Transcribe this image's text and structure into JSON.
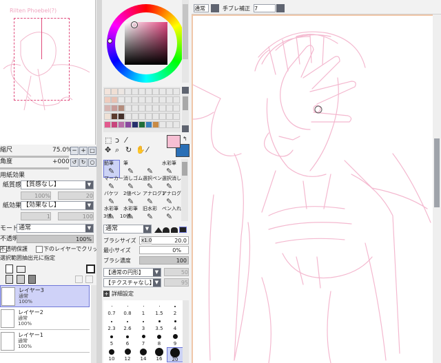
{
  "colors": {
    "accent": "#6d76d8",
    "sketch": "#f4b8cf",
    "primary": "#f6bfd3",
    "secondary": "#2a6fb6",
    "navigator_frame": "#e0487a"
  },
  "top_toolbar": {
    "blend_mode": "通常",
    "stabilizer_label": "手ブレ補正",
    "stabilizer_value": "7"
  },
  "navigator": {
    "zoom_label": "縮尺",
    "zoom_value": "75.0%",
    "angle_label": "角度",
    "angle_value": "+000°"
  },
  "layer_props": {
    "paper_section": "用紙効果",
    "paper_texture_label": "紙質感",
    "paper_texture_value": "【質感なし】",
    "paper_value_a": "100%",
    "paper_value_b": "20",
    "effect_label": "紙効果",
    "effect_value": "【効果なし】",
    "effect_value_a": "1",
    "effect_value_b": "100",
    "mode_label": "モード",
    "mode_value": "通常",
    "opacity_label": "不透明度",
    "opacity_value": "100%",
    "protect_label": "不透明保護",
    "clip_label": "下のレイヤーでクリッピング",
    "selection_label": "選択範囲抽出元に指定"
  },
  "layers": [
    {
      "name": "レイヤー3",
      "mode": "通常",
      "opacity": "100%",
      "selected": true
    },
    {
      "name": "レイヤー2",
      "mode": "通常",
      "opacity": "100%",
      "selected": false
    },
    {
      "name": "レイヤー1",
      "mode": "通常",
      "opacity": "100%",
      "selected": false
    }
  ],
  "tools": [
    {
      "label": "鉛筆",
      "icon": "pencil-icon",
      "selected": true
    },
    {
      "label": "筆",
      "icon": "brush-icon",
      "selected": false
    },
    {
      "label": "",
      "icon": "spray-icon",
      "selected": false
    },
    {
      "label": "水彩筆",
      "icon": "watercolor-icon",
      "selected": false
    },
    {
      "label": "マーカー",
      "icon": "marker-icon",
      "selected": false
    },
    {
      "label": "消しゴム",
      "icon": "eraser-icon",
      "selected": false
    },
    {
      "label": "選択ペン",
      "icon": "select-pen-icon",
      "selected": false
    },
    {
      "label": "選択消し",
      "icon": "select-erase-icon",
      "selected": false
    },
    {
      "label": "バケツ",
      "icon": "bucket-icon",
      "selected": false
    },
    {
      "label": "2値ペン",
      "icon": "binary-pen-icon",
      "selected": false
    },
    {
      "label": "アナログ1",
      "icon": "analog1-icon",
      "selected": false
    },
    {
      "label": "アナログ2",
      "icon": "analog2-icon",
      "selected": false
    },
    {
      "label": "水彩筆",
      "icon": "watercolor2-icon",
      "selected": false
    },
    {
      "label": "水彩筆",
      "icon": "watercolor3-icon",
      "selected": false
    },
    {
      "label": "旧水彩",
      "icon": "old-watercolor-icon",
      "selected": false
    },
    {
      "label": "ペン入れ",
      "icon": "inking-pen-icon",
      "selected": false
    }
  ],
  "tool_sub_labels": [
    "3値",
    "10値"
  ],
  "brush": {
    "mode": "通常",
    "size_label": "ブラシサイズ",
    "size_multiplier": "x1.0",
    "size_value": "20.0",
    "min_size_label": "最小サイズ",
    "min_size_value": "0%",
    "density_label": "ブラシ濃度",
    "density_value": "100",
    "shape_value": "【通常の円形】",
    "texture_value": "【テクスチャなし】",
    "shape_strength": "50",
    "texture_strength": "95",
    "advanced_label": "詳細設定"
  },
  "brush_sizes": [
    {
      "label": "0.7",
      "dot": 1
    },
    {
      "label": "0.8",
      "dot": 1
    },
    {
      "label": "1",
      "dot": 1
    },
    {
      "label": "1.5",
      "dot": 1
    },
    {
      "label": "2",
      "dot": 2
    },
    {
      "label": "2.3",
      "dot": 2
    },
    {
      "label": "2.6",
      "dot": 2
    },
    {
      "label": "3",
      "dot": 2
    },
    {
      "label": "3.5",
      "dot": 3
    },
    {
      "label": "4",
      "dot": 3
    },
    {
      "label": "5",
      "dot": 4
    },
    {
      "label": "6",
      "dot": 4
    },
    {
      "label": "7",
      "dot": 5
    },
    {
      "label": "8",
      "dot": 6
    },
    {
      "label": "9",
      "dot": 7
    },
    {
      "label": "10",
      "dot": 8
    },
    {
      "label": "12",
      "dot": 9
    },
    {
      "label": "14",
      "dot": 10
    },
    {
      "label": "16",
      "dot": 12
    },
    {
      "label": "20",
      "dot": 14
    }
  ],
  "palette_colors": [
    "#f3e4dc",
    "#f0dfd4",
    "#ece6e2",
    "#e8e8e8",
    "#e7e7e7",
    "#e8e8e8",
    "#e8e8e8",
    "#e8e8e8",
    "#e8e8e8",
    "#e8e8e8",
    "#e8e8e8",
    "#efcdbf",
    "#e8c1b3",
    "#e9e9e9",
    "#e8e8e8",
    "#e8e8e8",
    "#e8e8e8",
    "#e8e8e8",
    "#e8e8e8",
    "#e8e8e8",
    "#e8e8e8",
    "#e8e8e8",
    "#d7b4b1",
    "#c79b98",
    "#b38c7c",
    "#e8e8e8",
    "#e8e8e8",
    "#e8e8e8",
    "#e8e8e8",
    "#e8e8e8",
    "#e8e8e8",
    "#e8e8e8",
    "#e8e8e8",
    "#efe1d6",
    "#5b3c2e",
    "#45302a",
    "#e9e9e9",
    "#e8e8e8",
    "#e8e8e8",
    "#e8e8e8",
    "#e8e8e8",
    "#e8e8e8",
    "#e8e8e8",
    "#e8e8e8",
    "#e25a8e",
    "#c8457c",
    "#b86ca8",
    "#8a4aa0",
    "#26306c",
    "#1f6e38",
    "#3a7fbf",
    "#c88a45",
    "#e8e8e8",
    "#e8e8e8",
    "#e8e8e8"
  ],
  "navigator_sketch_text": "Rilten Phoebel(?)"
}
